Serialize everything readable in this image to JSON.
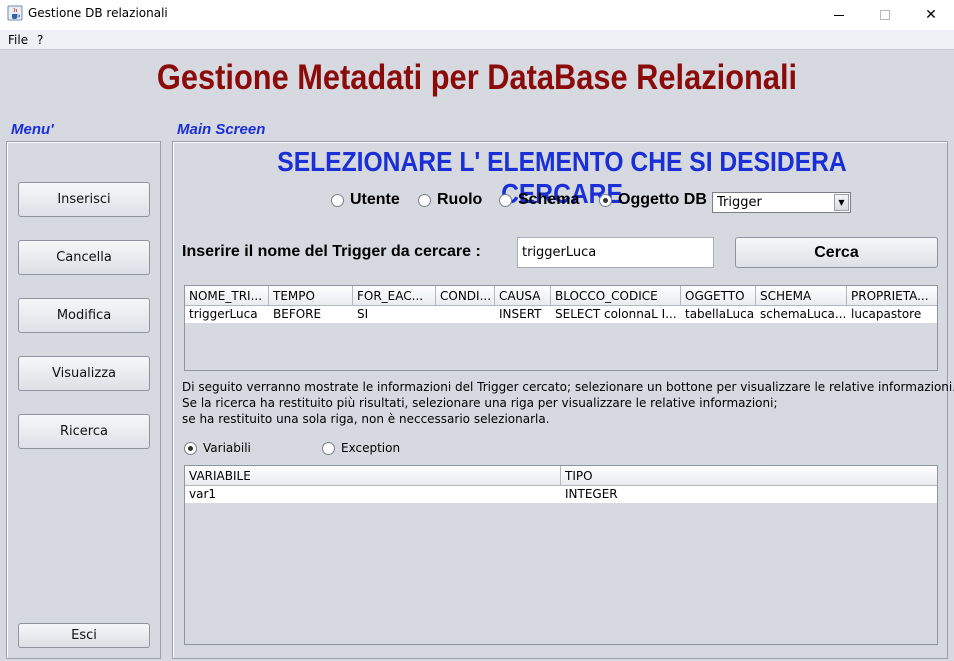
{
  "window": {
    "title": "Gestione DB relazionali",
    "icon": "java-cup-icon",
    "controls": {
      "minimize": "minimize-icon",
      "maximize": "maximize-icon",
      "close": "✕"
    }
  },
  "menubar": {
    "items": [
      "File",
      "?"
    ]
  },
  "header": {
    "title": "Gestione Metadati per DataBase Relazionali",
    "color": "#8b0a0a"
  },
  "sidebar": {
    "label": "Menu'",
    "buttons": [
      "Inserisci",
      "Cancella",
      "Modifica",
      "Visualizza",
      "Ricerca"
    ],
    "exit_button": "Esci"
  },
  "main": {
    "label": "Main Screen",
    "heading": "SELEZIONARE L' ELEMENTO CHE SI DESIDERA CERCARE",
    "accent_color": "#1b2fd6",
    "radio_options": [
      {
        "label": "Utente",
        "selected": false
      },
      {
        "label": "Ruolo",
        "selected": false
      },
      {
        "label": "Schema",
        "selected": false
      },
      {
        "label": "Oggetto DB",
        "selected": true
      }
    ],
    "object_type": "Trigger",
    "prompt": "Inserire il nome del Trigger da cercare :",
    "search_value": "triggerLuca",
    "search_button": "Cerca",
    "results_table": {
      "columns": [
        "NOME_TRI...",
        "TEMPO",
        "FOR_EAC...",
        "CONDI...",
        "CAUSA",
        "BLOCCO_CODICE",
        "OGGETTO",
        "SCHEMA",
        "PROPRIETA..."
      ],
      "rows": [
        [
          "triggerLuca",
          "BEFORE",
          "SI",
          "",
          "INSERT",
          "SELECT colonnaL I...",
          "tabellaLuca",
          "schemaLuca...",
          "lucapastore"
        ]
      ]
    },
    "info_lines": [
      "Di seguito verranno mostrate le informazioni del Trigger cercato; selezionare un bottone per visualizzare le relative informazioni.",
      "Se la ricerca ha restituito più risultati, selezionare una riga per visualizzare le relative informazioni;",
      "se ha restituito una sola riga, non è neccessario selezionarla."
    ],
    "detail_radios": [
      {
        "label": "Variabili",
        "selected": true
      },
      {
        "label": "Exception",
        "selected": false
      }
    ],
    "detail_table": {
      "columns": [
        "VARIABILE",
        "TIPO"
      ],
      "rows": [
        [
          "var1",
          "INTEGER"
        ]
      ]
    }
  }
}
